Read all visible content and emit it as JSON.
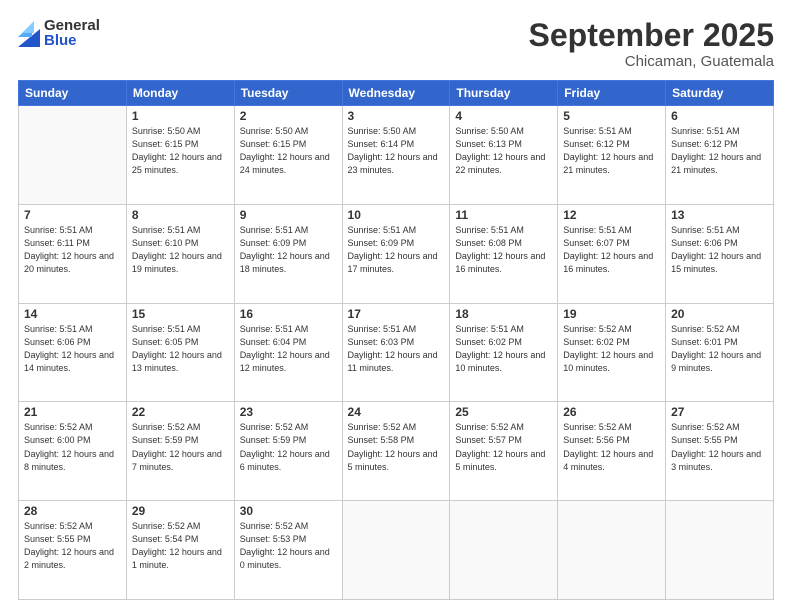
{
  "logo": {
    "general": "General",
    "blue": "Blue"
  },
  "header": {
    "month": "September 2025",
    "location": "Chicaman, Guatemala"
  },
  "weekdays": [
    "Sunday",
    "Monday",
    "Tuesday",
    "Wednesday",
    "Thursday",
    "Friday",
    "Saturday"
  ],
  "weeks": [
    [
      {
        "day": "",
        "sunrise": "",
        "sunset": "",
        "daylight": ""
      },
      {
        "day": "1",
        "sunrise": "Sunrise: 5:50 AM",
        "sunset": "Sunset: 6:15 PM",
        "daylight": "Daylight: 12 hours and 25 minutes."
      },
      {
        "day": "2",
        "sunrise": "Sunrise: 5:50 AM",
        "sunset": "Sunset: 6:15 PM",
        "daylight": "Daylight: 12 hours and 24 minutes."
      },
      {
        "day": "3",
        "sunrise": "Sunrise: 5:50 AM",
        "sunset": "Sunset: 6:14 PM",
        "daylight": "Daylight: 12 hours and 23 minutes."
      },
      {
        "day": "4",
        "sunrise": "Sunrise: 5:50 AM",
        "sunset": "Sunset: 6:13 PM",
        "daylight": "Daylight: 12 hours and 22 minutes."
      },
      {
        "day": "5",
        "sunrise": "Sunrise: 5:51 AM",
        "sunset": "Sunset: 6:12 PM",
        "daylight": "Daylight: 12 hours and 21 minutes."
      },
      {
        "day": "6",
        "sunrise": "Sunrise: 5:51 AM",
        "sunset": "Sunset: 6:12 PM",
        "daylight": "Daylight: 12 hours and 21 minutes."
      }
    ],
    [
      {
        "day": "7",
        "sunrise": "Sunrise: 5:51 AM",
        "sunset": "Sunset: 6:11 PM",
        "daylight": "Daylight: 12 hours and 20 minutes."
      },
      {
        "day": "8",
        "sunrise": "Sunrise: 5:51 AM",
        "sunset": "Sunset: 6:10 PM",
        "daylight": "Daylight: 12 hours and 19 minutes."
      },
      {
        "day": "9",
        "sunrise": "Sunrise: 5:51 AM",
        "sunset": "Sunset: 6:09 PM",
        "daylight": "Daylight: 12 hours and 18 minutes."
      },
      {
        "day": "10",
        "sunrise": "Sunrise: 5:51 AM",
        "sunset": "Sunset: 6:09 PM",
        "daylight": "Daylight: 12 hours and 17 minutes."
      },
      {
        "day": "11",
        "sunrise": "Sunrise: 5:51 AM",
        "sunset": "Sunset: 6:08 PM",
        "daylight": "Daylight: 12 hours and 16 minutes."
      },
      {
        "day": "12",
        "sunrise": "Sunrise: 5:51 AM",
        "sunset": "Sunset: 6:07 PM",
        "daylight": "Daylight: 12 hours and 16 minutes."
      },
      {
        "day": "13",
        "sunrise": "Sunrise: 5:51 AM",
        "sunset": "Sunset: 6:06 PM",
        "daylight": "Daylight: 12 hours and 15 minutes."
      }
    ],
    [
      {
        "day": "14",
        "sunrise": "Sunrise: 5:51 AM",
        "sunset": "Sunset: 6:06 PM",
        "daylight": "Daylight: 12 hours and 14 minutes."
      },
      {
        "day": "15",
        "sunrise": "Sunrise: 5:51 AM",
        "sunset": "Sunset: 6:05 PM",
        "daylight": "Daylight: 12 hours and 13 minutes."
      },
      {
        "day": "16",
        "sunrise": "Sunrise: 5:51 AM",
        "sunset": "Sunset: 6:04 PM",
        "daylight": "Daylight: 12 hours and 12 minutes."
      },
      {
        "day": "17",
        "sunrise": "Sunrise: 5:51 AM",
        "sunset": "Sunset: 6:03 PM",
        "daylight": "Daylight: 12 hours and 11 minutes."
      },
      {
        "day": "18",
        "sunrise": "Sunrise: 5:51 AM",
        "sunset": "Sunset: 6:02 PM",
        "daylight": "Daylight: 12 hours and 10 minutes."
      },
      {
        "day": "19",
        "sunrise": "Sunrise: 5:52 AM",
        "sunset": "Sunset: 6:02 PM",
        "daylight": "Daylight: 12 hours and 10 minutes."
      },
      {
        "day": "20",
        "sunrise": "Sunrise: 5:52 AM",
        "sunset": "Sunset: 6:01 PM",
        "daylight": "Daylight: 12 hours and 9 minutes."
      }
    ],
    [
      {
        "day": "21",
        "sunrise": "Sunrise: 5:52 AM",
        "sunset": "Sunset: 6:00 PM",
        "daylight": "Daylight: 12 hours and 8 minutes."
      },
      {
        "day": "22",
        "sunrise": "Sunrise: 5:52 AM",
        "sunset": "Sunset: 5:59 PM",
        "daylight": "Daylight: 12 hours and 7 minutes."
      },
      {
        "day": "23",
        "sunrise": "Sunrise: 5:52 AM",
        "sunset": "Sunset: 5:59 PM",
        "daylight": "Daylight: 12 hours and 6 minutes."
      },
      {
        "day": "24",
        "sunrise": "Sunrise: 5:52 AM",
        "sunset": "Sunset: 5:58 PM",
        "daylight": "Daylight: 12 hours and 5 minutes."
      },
      {
        "day": "25",
        "sunrise": "Sunrise: 5:52 AM",
        "sunset": "Sunset: 5:57 PM",
        "daylight": "Daylight: 12 hours and 5 minutes."
      },
      {
        "day": "26",
        "sunrise": "Sunrise: 5:52 AM",
        "sunset": "Sunset: 5:56 PM",
        "daylight": "Daylight: 12 hours and 4 minutes."
      },
      {
        "day": "27",
        "sunrise": "Sunrise: 5:52 AM",
        "sunset": "Sunset: 5:55 PM",
        "daylight": "Daylight: 12 hours and 3 minutes."
      }
    ],
    [
      {
        "day": "28",
        "sunrise": "Sunrise: 5:52 AM",
        "sunset": "Sunset: 5:55 PM",
        "daylight": "Daylight: 12 hours and 2 minutes."
      },
      {
        "day": "29",
        "sunrise": "Sunrise: 5:52 AM",
        "sunset": "Sunset: 5:54 PM",
        "daylight": "Daylight: 12 hours and 1 minute."
      },
      {
        "day": "30",
        "sunrise": "Sunrise: 5:52 AM",
        "sunset": "Sunset: 5:53 PM",
        "daylight": "Daylight: 12 hours and 0 minutes."
      },
      {
        "day": "",
        "sunrise": "",
        "sunset": "",
        "daylight": ""
      },
      {
        "day": "",
        "sunrise": "",
        "sunset": "",
        "daylight": ""
      },
      {
        "day": "",
        "sunrise": "",
        "sunset": "",
        "daylight": ""
      },
      {
        "day": "",
        "sunrise": "",
        "sunset": "",
        "daylight": ""
      }
    ]
  ]
}
